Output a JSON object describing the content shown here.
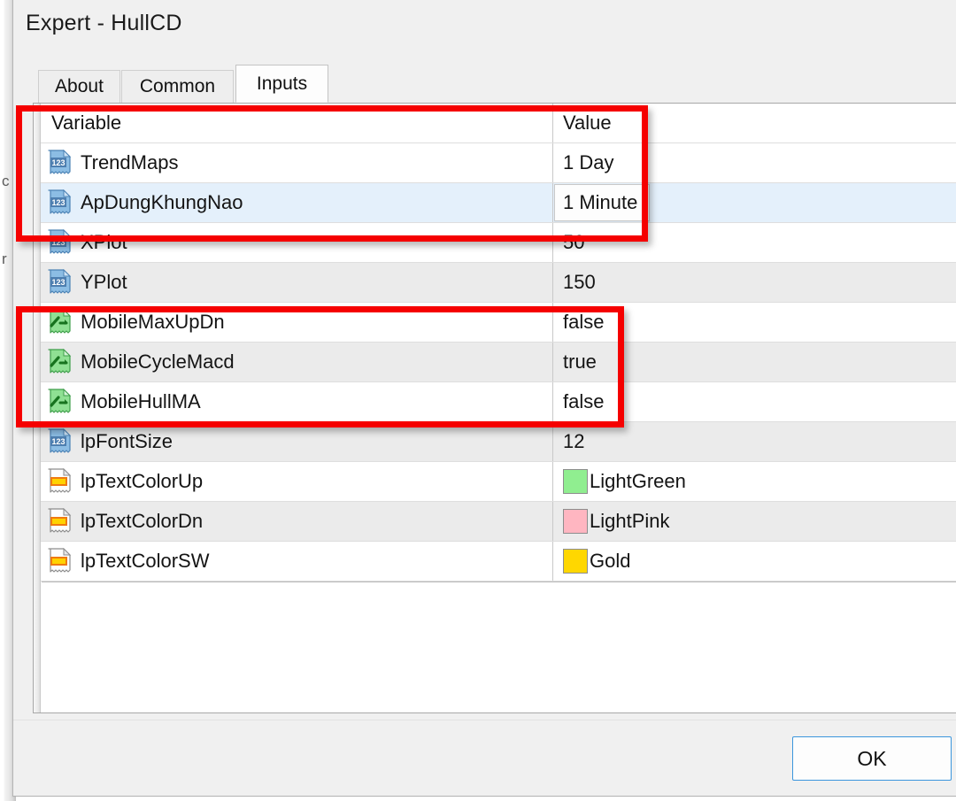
{
  "window": {
    "title": "Expert - HullCD"
  },
  "tabs": [
    {
      "label": "About",
      "active": false
    },
    {
      "label": "Common",
      "active": false
    },
    {
      "label": "Inputs",
      "active": true
    }
  ],
  "grid": {
    "columns": [
      "Variable",
      "Value"
    ],
    "rows": [
      {
        "icon": "number-123-icon",
        "variable": "TrendMaps",
        "value": "1 Day",
        "state": "normal"
      },
      {
        "icon": "number-123-icon",
        "variable": "ApDungKhungNao",
        "value": "1 Minute",
        "state": "selected-editing"
      },
      {
        "icon": "number-123-icon",
        "variable": "XPlot",
        "value": "50",
        "state": "normal"
      },
      {
        "icon": "number-123-icon",
        "variable": "YPlot",
        "value": "150",
        "state": "alt"
      },
      {
        "icon": "boolean-icon",
        "variable": "MobileMaxUpDn",
        "value": "false",
        "state": "normal"
      },
      {
        "icon": "boolean-icon",
        "variable": "MobileCycleMacd",
        "value": "true",
        "state": "alt"
      },
      {
        "icon": "boolean-icon",
        "variable": "MobileHullMA",
        "value": "false",
        "state": "normal"
      },
      {
        "icon": "number-123-icon",
        "variable": "lpFontSize",
        "value": "12",
        "state": "alt"
      },
      {
        "icon": "color-icon",
        "variable": "lpTextColorUp",
        "value": "LightGreen",
        "swatch": "#90EE90",
        "state": "normal"
      },
      {
        "icon": "color-icon",
        "variable": "lpTextColorDn",
        "value": "LightPink",
        "swatch": "#FFB6C1",
        "state": "alt"
      },
      {
        "icon": "color-icon",
        "variable": "lpTextColorSW",
        "value": "Gold",
        "swatch": "#FFD700",
        "state": "normal"
      }
    ]
  },
  "footer": {
    "ok_label": "OK"
  },
  "annotations": [
    {
      "name": "highlight-timeframe-rows",
      "color": "#F50000"
    },
    {
      "name": "highlight-mobile-bool-rows",
      "color": "#F50000"
    }
  ],
  "colors": {
    "annotation_red": "#F50000",
    "selected_row": "#E4F0FB",
    "focus_blue": "#3B96DD",
    "alt_row": "#EBEBEB",
    "dialog_bg": "#F0F0F0"
  },
  "backdrop_fragments": [
    "c",
    "r"
  ]
}
